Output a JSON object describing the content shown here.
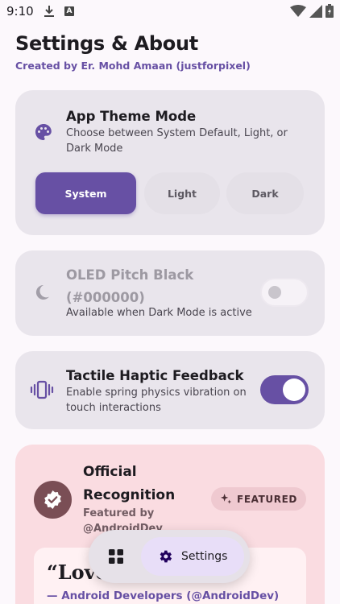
{
  "status_bar": {
    "time": "9:10",
    "a_badge": "A"
  },
  "header": {
    "title": "Settings & About",
    "subtitle": "Created by Er. Mohd Amaan (justforpixel)"
  },
  "theme_card": {
    "title": "App Theme Mode",
    "description": "Choose between System Default, Light, or Dark Mode",
    "options": [
      "System",
      "Light",
      "Dark"
    ],
    "selected": "System"
  },
  "oled_card": {
    "title": "OLED Pitch Black (#000000)",
    "description": "Available when Dark Mode is active",
    "enabled": false
  },
  "haptic_card": {
    "title": "Tactile Haptic Feedback",
    "description": "Enable spring physics vibration on touch interactions",
    "enabled": true
  },
  "recognition_card": {
    "title": "Official Recognition",
    "subtitle": "Featured by @AndroidDev",
    "chip": "FEATURED",
    "quote": "“Love",
    "attribution": "— Android Developers (@AndroidDev)"
  },
  "bottom_nav": {
    "active_label": "Settings"
  },
  "colors": {
    "accent": "#6750A4",
    "card_bg": "#E9E5EC",
    "recognition_bg": "#FADCE1"
  }
}
